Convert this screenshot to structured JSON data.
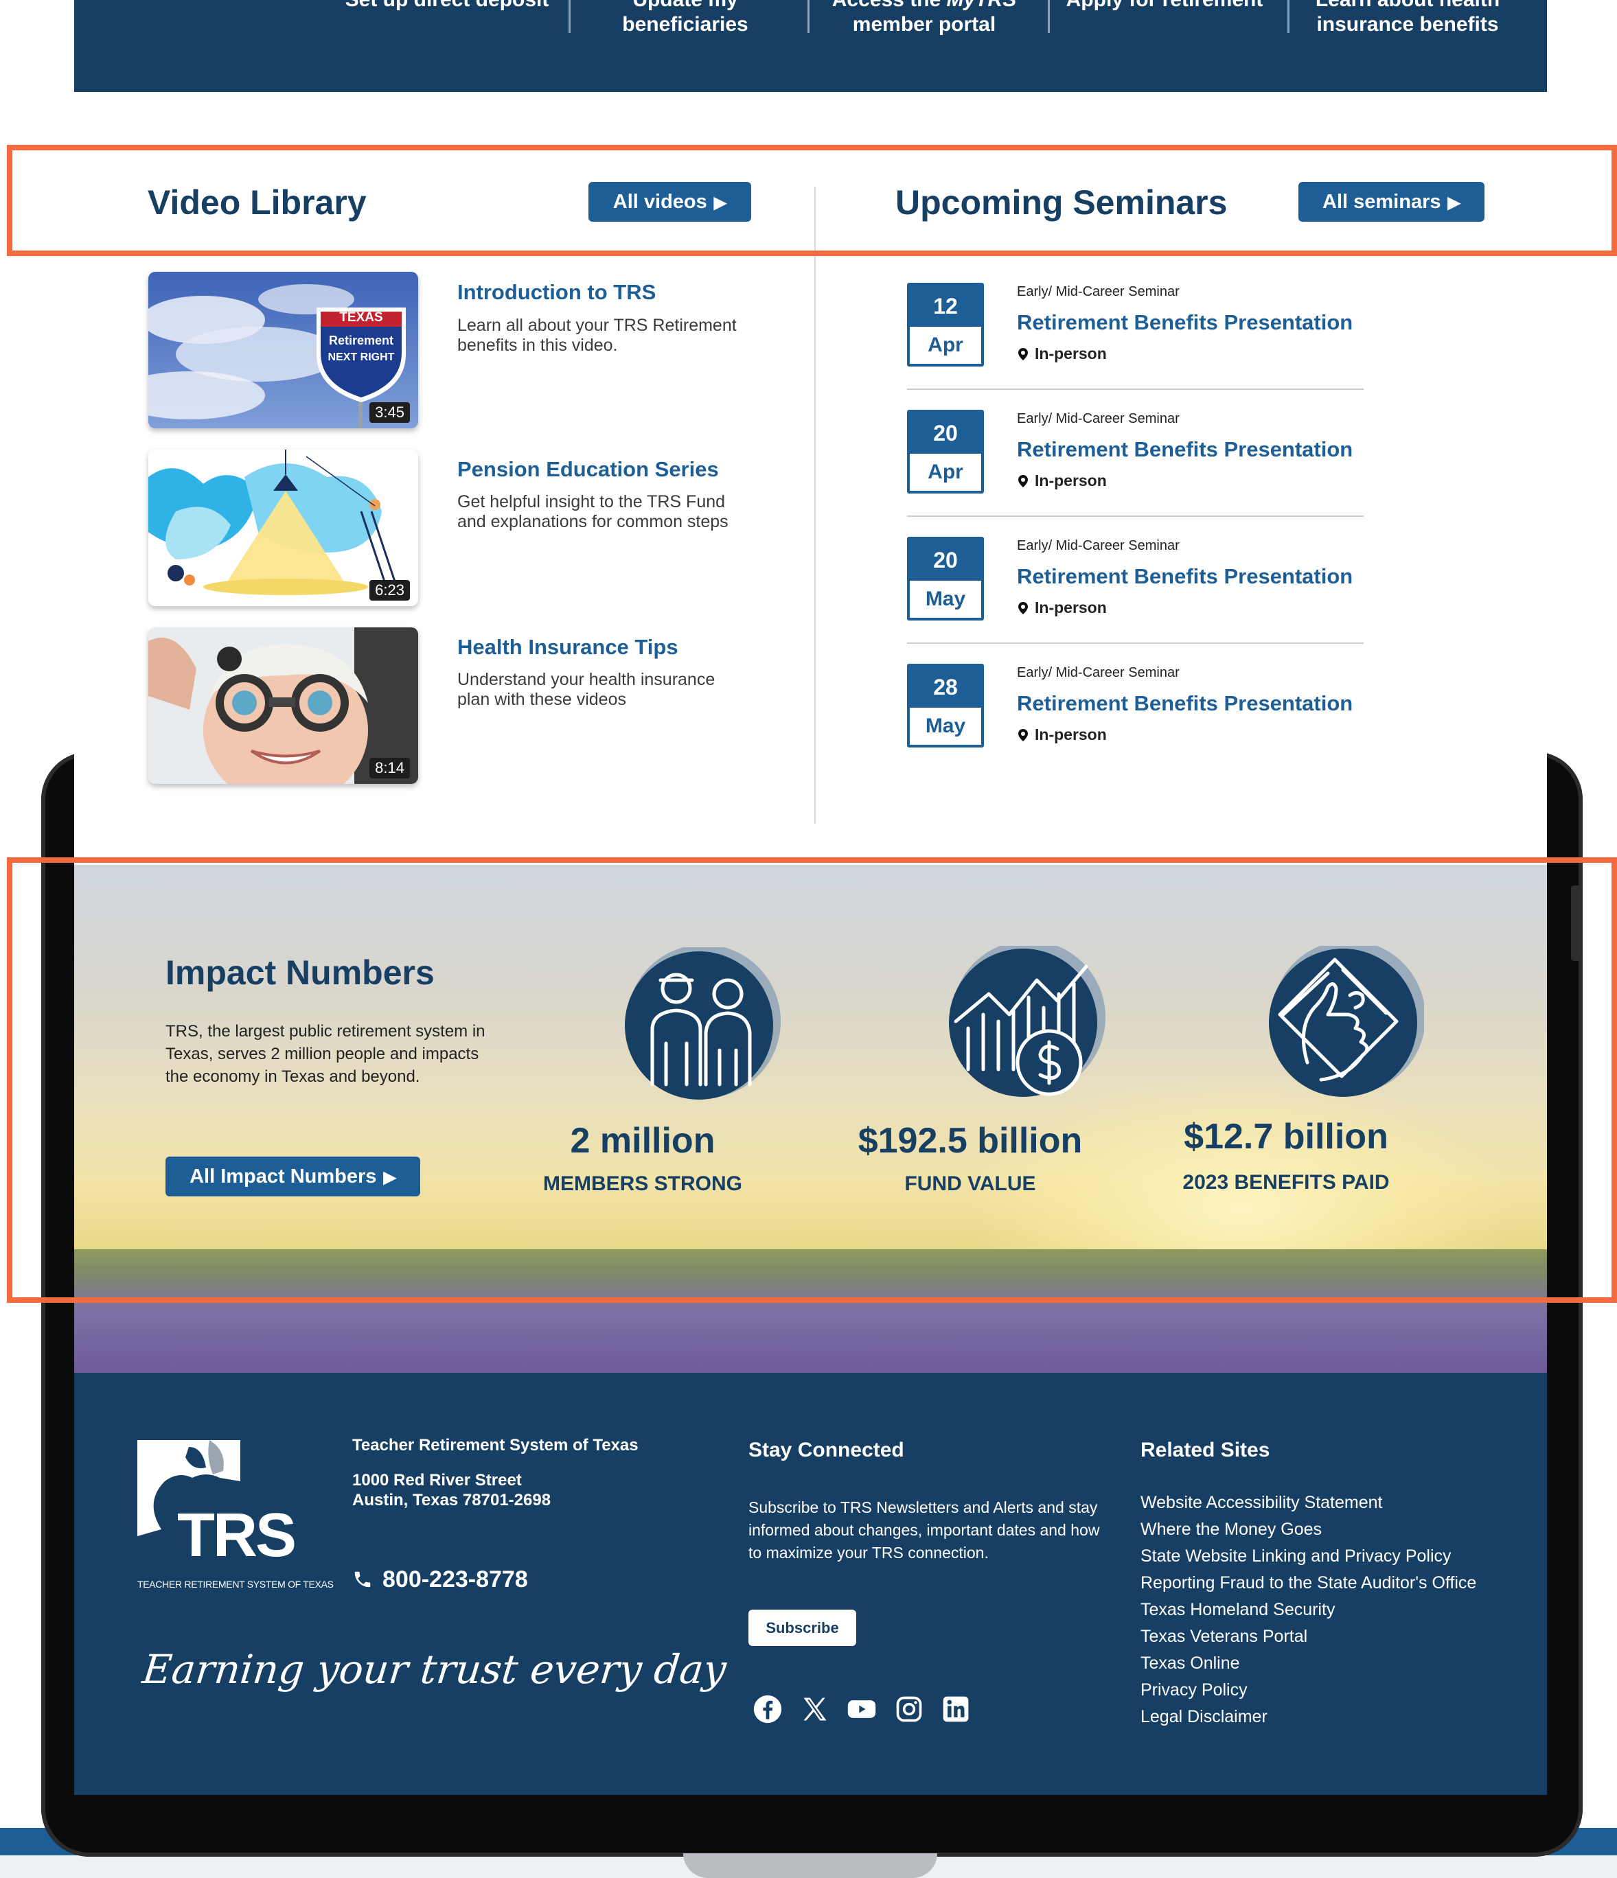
{
  "top_nav": [
    {
      "label": "Set up direct deposit"
    },
    {
      "label": "Update my beneficiaries"
    },
    {
      "label_pre": "Access the ",
      "label_em": "MyTRS",
      "label_post": " member portal"
    },
    {
      "label": "Apply for retirement"
    },
    {
      "label": "Learn about health insurance benefits"
    }
  ],
  "video_library": {
    "title": "Video Library",
    "all_button": "All videos",
    "videos": [
      {
        "title": "Introduction to TRS",
        "description": "Learn all about your TRS Retirement benefits in this video.",
        "duration": "3:45",
        "sign_top": "TEXAS",
        "sign_line1": "Retirement",
        "sign_line2": "NEXT RIGHT"
      },
      {
        "title": "Pension Education Series",
        "description": "Get helpful insight to the TRS Fund and explanations for common steps",
        "duration": "6:23"
      },
      {
        "title": "Health Insurance Tips",
        "description": "Understand your health insurance plan with these videos",
        "duration": "8:14"
      }
    ]
  },
  "seminars": {
    "title": "Upcoming Seminars",
    "all_button": "All seminars",
    "items": [
      {
        "day": "12",
        "month": "Apr",
        "category": "Early/ Mid-Career Seminar",
        "title": "Retirement Benefits Presentation",
        "location": "In-person"
      },
      {
        "day": "20",
        "month": "Apr",
        "category": "Early/ Mid-Career Seminar",
        "title": "Retirement Benefits Presentation",
        "location": "In-person"
      },
      {
        "day": "20",
        "month": "May",
        "category": "Early/ Mid-Career Seminar",
        "title": "Retirement Benefits Presentation",
        "location": "In-person"
      },
      {
        "day": "28",
        "month": "May",
        "category": "Early/ Mid-Career Seminar",
        "title": "Retirement Benefits Presentation",
        "location": "In-person"
      }
    ]
  },
  "impact": {
    "title": "Impact Numbers",
    "description": "TRS, the largest public retirement system in Texas, serves 2 million people and impacts the economy in Texas and beyond.",
    "button": "All Impact Numbers",
    "stats": [
      {
        "value": "2 million",
        "label": "MEMBERS STRONG",
        "icon": "members-icon"
      },
      {
        "value": "$192.5 billion",
        "label": "FUND VALUE",
        "icon": "fund-chart-icon"
      },
      {
        "value": "$12.7 billion",
        "label": "2023 BENEFITS PAID",
        "icon": "money-hand-icon"
      }
    ]
  },
  "footer": {
    "logo_text": "TRS",
    "logo_subtext": "TEACHER RETIREMENT SYSTEM OF TEXAS",
    "org_name": "Teacher Retirement System of Texas",
    "address_line1": "1000 Red River Street",
    "address_line2": "Austin, Texas 78701-2698",
    "phone": "800-223-8778",
    "tagline": "Earning your trust every day",
    "stay_connected": {
      "heading": "Stay Connected",
      "text": "Subscribe to TRS Newsletters and Alerts and stay informed about changes, important dates and how to maximize your TRS connection.",
      "button": "Subscribe",
      "social": [
        "facebook-icon",
        "x-icon",
        "youtube-icon",
        "instagram-icon",
        "linkedin-icon"
      ]
    },
    "related_sites": {
      "heading": "Related Sites",
      "links": [
        "Website Accessibility Statement",
        "Where the Money Goes",
        "State Website Linking and Privacy Policy",
        "Reporting Fraud to the State Auditor's Office",
        "Texas Homeland Security",
        "Texas Veterans Portal",
        "Texas Online",
        "Privacy Policy",
        "Legal Disclaimer"
      ]
    }
  },
  "colors": {
    "navy": "#173f63",
    "blue": "#1d5e96",
    "highlight": "#f26a3d"
  }
}
